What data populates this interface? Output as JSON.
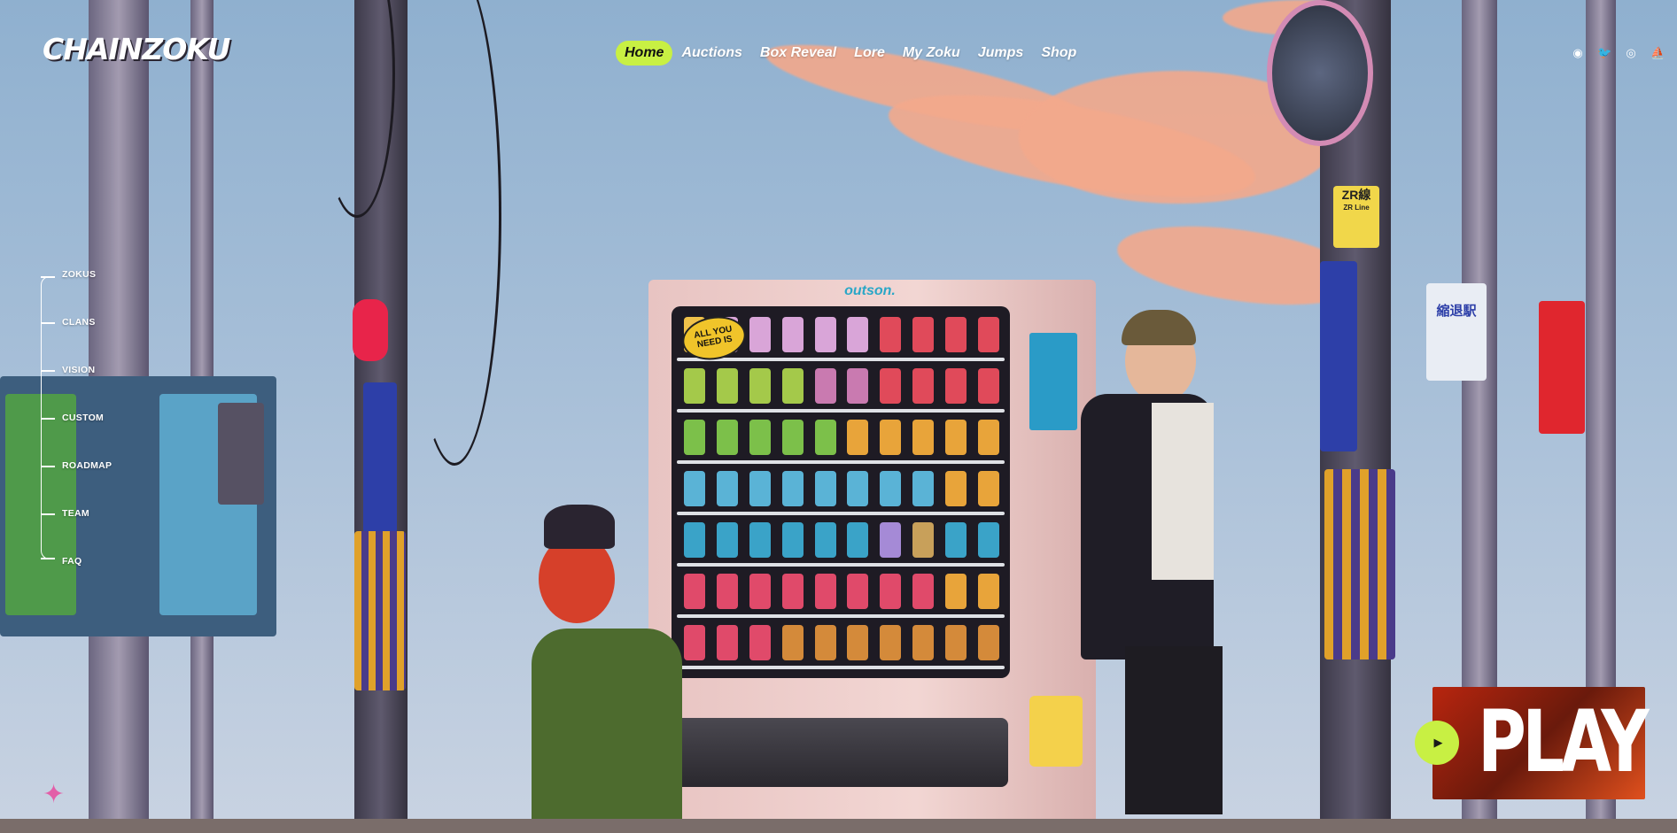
{
  "brand": {
    "logo_text": "CHAINZOKU"
  },
  "nav": {
    "items": [
      {
        "label": "Home",
        "active": true
      },
      {
        "label": "Auctions",
        "active": false
      },
      {
        "label": "Box Reveal",
        "active": false
      },
      {
        "label": "Lore",
        "active": false
      },
      {
        "label": "My Zoku",
        "active": false
      },
      {
        "label": "Jumps",
        "active": false
      },
      {
        "label": "Shop",
        "active": false
      }
    ],
    "active_color": "#c8f043"
  },
  "social": {
    "icons": [
      "discord-icon",
      "twitter-icon",
      "instagram-icon",
      "opensea-icon"
    ],
    "glyphs": [
      "◉",
      "🐦",
      "◎",
      "⛵"
    ]
  },
  "sidenav": {
    "items": [
      "ZOKUS",
      "CLANS",
      "VISION",
      "CUSTOM",
      "ROADMAP",
      "TEAM",
      "FAQ"
    ]
  },
  "scene": {
    "vending_machine_brand": "outson.",
    "sign_all_you_need": "ALL YOU NEED IS",
    "station_sign": "ZR線",
    "station_sub": "ZR Line",
    "station_name": "縮退駅"
  },
  "play": {
    "label": "PLAY",
    "button_icon": "play-icon"
  }
}
